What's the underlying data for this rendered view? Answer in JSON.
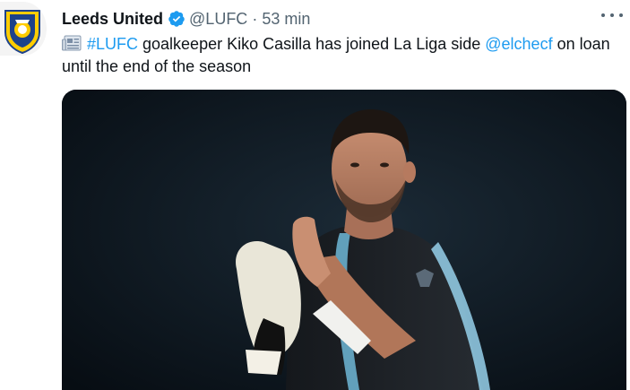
{
  "tweet": {
    "author_name": "Leeds United",
    "handle": "@LUFC",
    "separator": "·",
    "time": "53 min",
    "verified_color": "#1d9bf0",
    "text_icon": "newspaper-icon",
    "hashtag": "#LUFC",
    "text_1": " goalkeeper Kiko Casilla has joined La Liga side ",
    "mention": "@elchecf",
    "text_2": " on loan until the end of the season",
    "link_color": "#1d9bf0",
    "media_alt": "Kiko Casilla clapping in goalkeeper gloves"
  },
  "avatar": {
    "icon": "leeds-united-crest-icon",
    "colors": [
      "#ffcd00",
      "#1d428a",
      "#ffffff"
    ]
  },
  "more": {
    "icon": "more-horizontal-icon"
  }
}
